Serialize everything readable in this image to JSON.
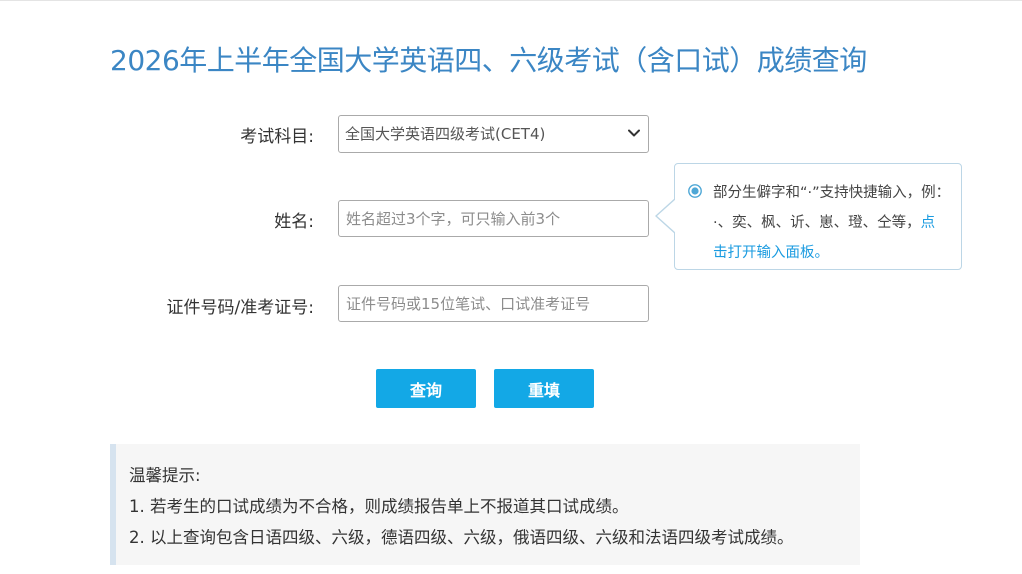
{
  "page_title": "2026年上半年全国大学英语四、六级考试（含口试）成绩查询",
  "form": {
    "subject_label": "考试科目:",
    "subject_selected": "全国大学英语四级考试(CET4)",
    "name_label": "姓名:",
    "name_placeholder": "姓名超过3个字，可只输入前3个",
    "id_label": "证件号码/准考证号:",
    "id_placeholder": "证件号码或15位笔试、口试准考证号"
  },
  "tooltip": {
    "text_part1": "部分生僻字和“·”支持快捷输入，例：·、奕、枫、䜣、崽、璒、仝等，",
    "link_text": "点击打开输入面板。"
  },
  "buttons": {
    "query_label": "查询",
    "reset_label": "重填"
  },
  "notice": {
    "title": "温馨提示:",
    "items": [
      "1. 若考生的口试成绩为不合格，则成绩报告单上不报道其口试成绩。",
      "2. 以上查询包含日语四级、六级，德语四级、六级，俄语四级、六级和法语四级考试成绩。"
    ]
  },
  "colors": {
    "title": "#3b86c4",
    "button_bg": "#13a8e6",
    "link": "#1a9be0",
    "notice_bg": "#f6f6f6",
    "notice_border": "#d6e3ef"
  },
  "icons": {
    "select_arrow": "chevron-down-icon",
    "tip_marker": "radio-dot-icon"
  }
}
